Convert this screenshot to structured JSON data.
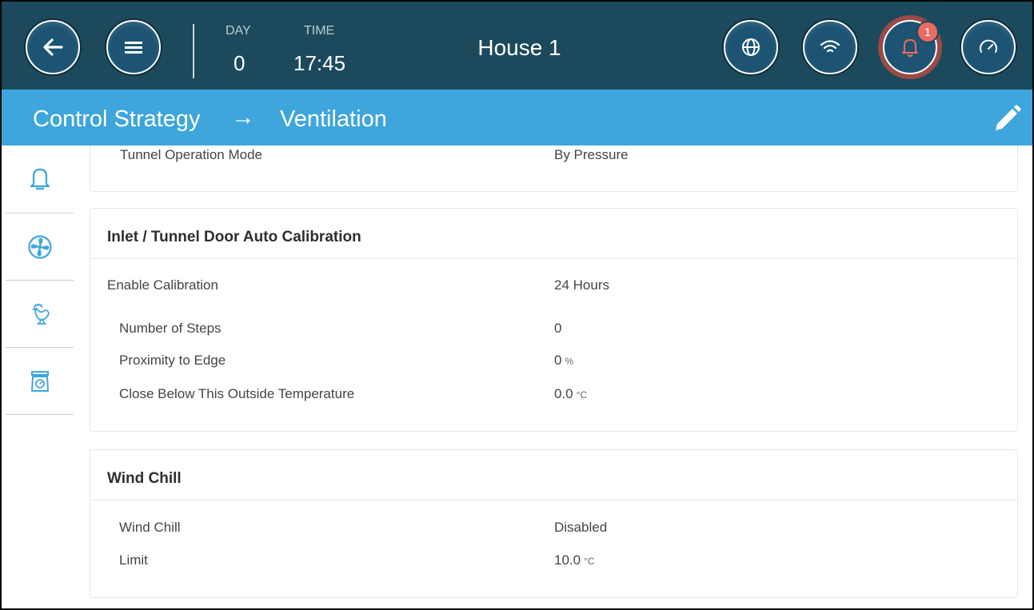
{
  "header": {
    "day_label": "DAY",
    "day_value": "0",
    "time_label": "TIME",
    "time_value": "17:45",
    "house_title": "House 1",
    "alarm_count": "1",
    "colors": {
      "topbar": "#1c4a5c",
      "button": "#1d5473",
      "alarm_ring": "#9a4a47",
      "badge": "#e96a62"
    }
  },
  "breadcrumb": {
    "items": [
      "Control Strategy",
      "Ventilation"
    ],
    "separator": "→",
    "color": "#3ea6dc"
  },
  "sidebar": {
    "items": [
      {
        "icon": "bell-icon"
      },
      {
        "icon": "fan-icon"
      },
      {
        "icon": "rooster-icon"
      },
      {
        "icon": "scale-icon"
      }
    ]
  },
  "cards": {
    "tunnel": {
      "rows": [
        {
          "label": "Tunnel Operation Mode",
          "value": "By Pressure",
          "unit": ""
        }
      ]
    },
    "calibration": {
      "title": "Inlet / Tunnel Door Auto Calibration",
      "rows": [
        {
          "label": "Enable Calibration",
          "value": "24 Hours",
          "unit": ""
        },
        {
          "label": "Number of Steps",
          "value": "0",
          "unit": ""
        },
        {
          "label": "Proximity to Edge",
          "value": "0",
          "unit": "%"
        },
        {
          "label": "Close Below This Outside Temperature",
          "value": "0.0",
          "unit": "°C"
        }
      ]
    },
    "windchill": {
      "title": "Wind Chill",
      "rows": [
        {
          "label": "Wind Chill",
          "value": "Disabled",
          "unit": ""
        },
        {
          "label": "Limit",
          "value": "10.0",
          "unit": "°C"
        }
      ]
    }
  }
}
